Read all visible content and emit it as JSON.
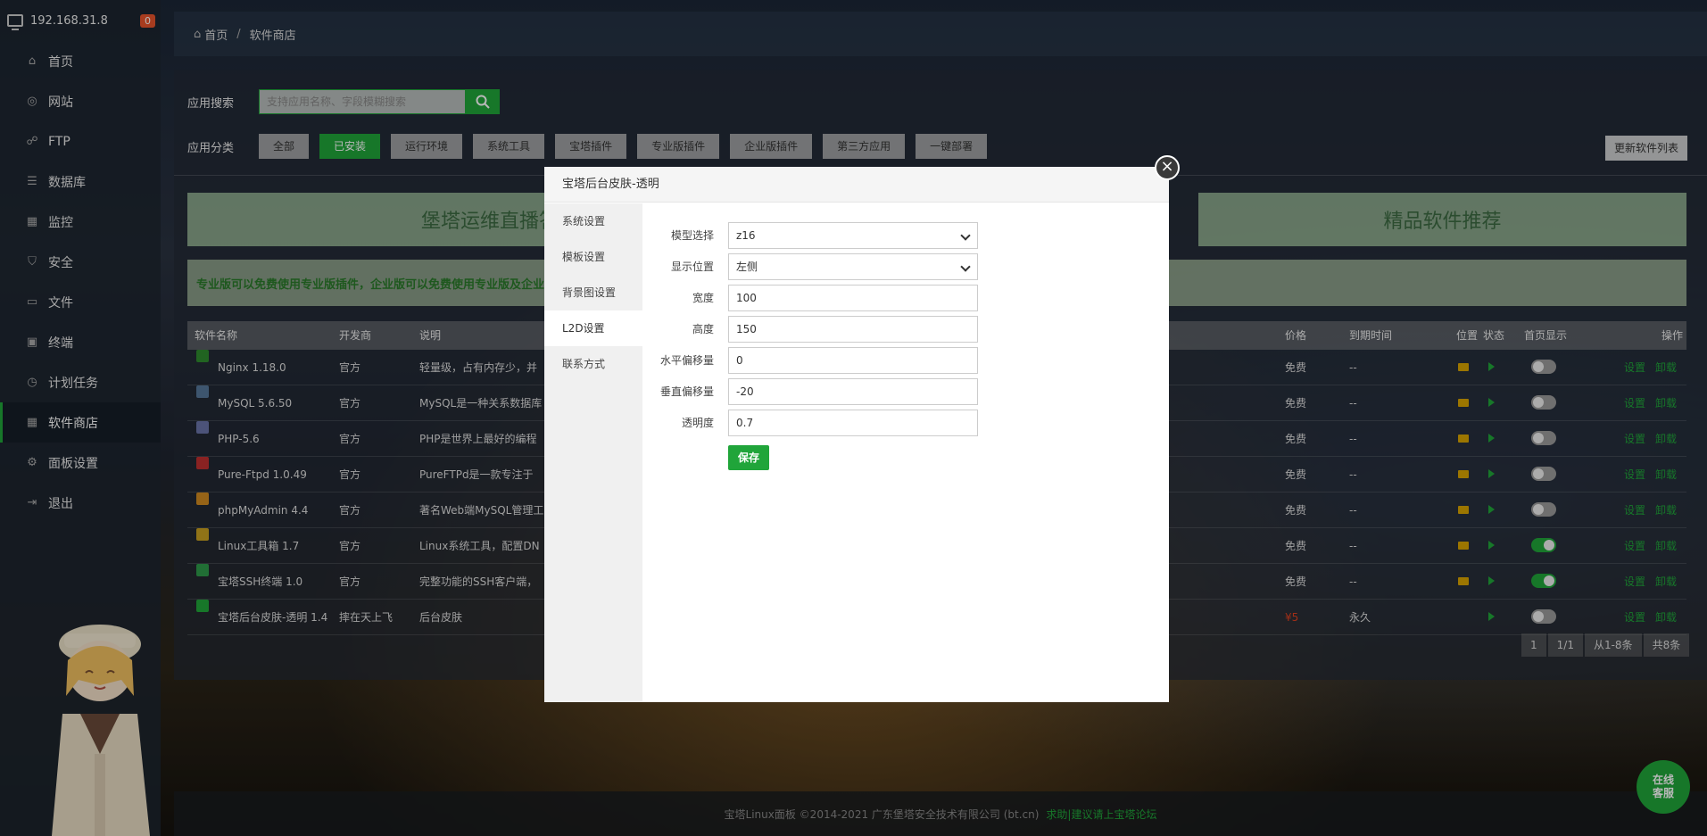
{
  "sidebar": {
    "ip": "192.168.31.8",
    "badge": "0",
    "items": [
      {
        "label": "首页",
        "icon": "home-icon"
      },
      {
        "label": "网站",
        "icon": "globe-icon"
      },
      {
        "label": "FTP",
        "icon": "ftp-icon"
      },
      {
        "label": "数据库",
        "icon": "database-icon"
      },
      {
        "label": "监控",
        "icon": "monitor-icon"
      },
      {
        "label": "安全",
        "icon": "shield-icon"
      },
      {
        "label": "文件",
        "icon": "folder-icon"
      },
      {
        "label": "终端",
        "icon": "terminal-icon"
      },
      {
        "label": "计划任务",
        "icon": "clock-icon"
      },
      {
        "label": "软件商店",
        "icon": "grid-icon"
      },
      {
        "label": "面板设置",
        "icon": "gear-icon"
      },
      {
        "label": "退出",
        "icon": "logout-icon"
      }
    ]
  },
  "breadcrumb": {
    "home": "首页",
    "sep": "/",
    "current": "软件商店"
  },
  "search": {
    "label": "应用搜索",
    "placeholder": "支持应用名称、字段模糊搜索"
  },
  "categories": {
    "label": "应用分类",
    "items": [
      "全部",
      "已安装",
      "运行环境",
      "系统工具",
      "宝塔插件",
      "专业版插件",
      "企业版插件",
      "第三方应用",
      "一键部署"
    ],
    "update": "更新软件列表"
  },
  "banners": {
    "left": "堡塔运维直播答疑",
    "right": "精品软件推荐"
  },
  "notice": "专业版可以免费使用专业版插件，企业版可以免费使用专业版及企业",
  "table": {
    "headers": {
      "name": "软件名称",
      "dev": "开发商",
      "desc": "说明",
      "price": "价格",
      "expire": "到期时间",
      "loc": "位置",
      "status": "状态",
      "home": "首页显示",
      "op": "操作"
    },
    "rows": [
      {
        "name": "Nginx 1.18.0",
        "dev": "官方",
        "desc": "轻量级，占有内存少，并",
        "price": "免费",
        "expire": "--",
        "icon_color": "#2e8b2e",
        "on": false
      },
      {
        "name": "MySQL 5.6.50",
        "dev": "官方",
        "desc": "MySQL是一种关系数据库",
        "price": "免费",
        "expire": "--",
        "icon_color": "#557799",
        "on": false
      },
      {
        "name": "PHP-5.6",
        "dev": "官方",
        "desc": "PHP是世界上最好的编程",
        "price": "免费",
        "expire": "--",
        "icon_color": "#6a74a8",
        "on": false
      },
      {
        "name": "Pure-Ftpd 1.0.49",
        "dev": "官方",
        "desc": "PureFTPd是一款专注于",
        "price": "免费",
        "expire": "--",
        "icon_color": "#c03030",
        "on": false
      },
      {
        "name": "phpMyAdmin 4.4",
        "dev": "官方",
        "desc": "著名Web端MySQL管理工",
        "price": "免费",
        "expire": "--",
        "icon_color": "#d08a20",
        "on": false
      },
      {
        "name": "Linux工具箱 1.7",
        "dev": "官方",
        "desc": "Linux系统工具，配置DN",
        "price": "免费",
        "expire": "--",
        "icon_color": "#c8a020",
        "on": true
      },
      {
        "name": "宝塔SSH终端 1.0",
        "dev": "官方",
        "desc": "完整功能的SSH客户端，",
        "price": "免费",
        "expire": "--",
        "icon_color": "#2e9a4a",
        "on": true
      },
      {
        "name": "宝塔后台皮肤-透明 1.4",
        "dev": "摔在天上飞",
        "desc": "后台皮肤",
        "price": "¥5",
        "expire": "永久",
        "icon_color": "#20a53a",
        "on": false
      }
    ],
    "op_settings": "设置",
    "op_uninstall": "卸载"
  },
  "pager": {
    "page": "1",
    "total_pages": "1/1",
    "range": "从1-8条",
    "count": "共8条"
  },
  "footer": {
    "copyright": "宝塔Linux面板 ©2014-2021 广东堡塔安全技术有限公司 (bt.cn)",
    "link": "求助|建议请上宝塔论坛"
  },
  "chat": {
    "line1": "在线",
    "line2": "客服"
  },
  "modal": {
    "title": "宝塔后台皮肤-透明",
    "menu": [
      "系统设置",
      "模板设置",
      "背景图设置",
      "L2D设置",
      "联系方式"
    ],
    "active_menu": "L2D设置",
    "fields": [
      {
        "label": "模型选择",
        "value": "z16",
        "type": "select"
      },
      {
        "label": "显示位置",
        "value": "左侧",
        "type": "select"
      },
      {
        "label": "宽度",
        "value": "100",
        "type": "input"
      },
      {
        "label": "高度",
        "value": "150",
        "type": "input"
      },
      {
        "label": "水平偏移量",
        "value": "0",
        "type": "input"
      },
      {
        "label": "垂直偏移量",
        "value": "-20",
        "type": "input"
      },
      {
        "label": "透明度",
        "value": "0.7",
        "type": "input"
      }
    ],
    "save": "保存"
  }
}
